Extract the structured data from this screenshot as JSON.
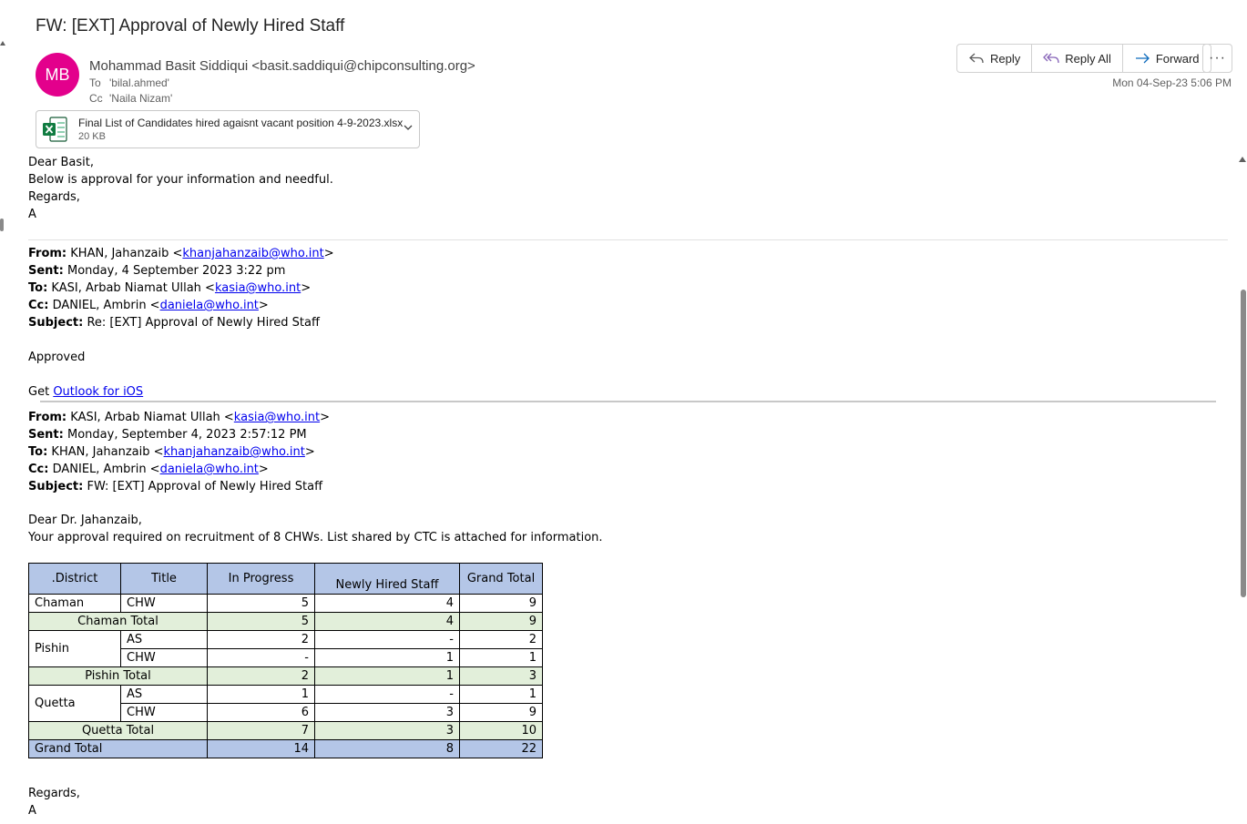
{
  "subject": "FW: [EXT] Approval of Newly Hired Staff",
  "sender": {
    "initials": "MB",
    "display": "Mohammad Basit Siddiqui <basit.saddiqui@chipconsulting.org>",
    "to_label": "To",
    "to": "'bilal.ahmed'",
    "cc_label": "Cc",
    "cc": "'Naila Nizam'"
  },
  "actions": {
    "reply": "Reply",
    "reply_all": "Reply All",
    "forward": "Forward",
    "more": "···"
  },
  "date": "Mon 04-Sep-23 5:06 PM",
  "attachment": {
    "name": "Final List of Candidates hired agaisnt vacant position 4-9-2023.xlsx",
    "size": "20 KB",
    "icon": "excel-icon"
  },
  "greeting": {
    "l1": "Dear Basit,",
    "l2": "Below is approval for your information and needful.",
    "l3": "Regards,",
    "l4": "A"
  },
  "fwd1": {
    "from_label": "From:",
    "from_name": "KHAN, Jahanzaib <",
    "from_email": "khanjahanzaib@who.int",
    "sent_label": "Sent:",
    "sent": "Monday, 4 September 2023 3:22 pm",
    "to_label": "To:",
    "to_name": "KASI, Arbab Niamat Ullah <",
    "to_email": "kasia@who.int",
    "cc_label": "Cc:",
    "cc_name": "DANIEL, Ambrin <",
    "cc_email": "daniela@who.int",
    "subject_label": "Subject:",
    "subject": "Re: [EXT] Approval of Newly Hired Staff",
    "body": "Approved",
    "get": "Get",
    "outlook_link": "Outlook for iOS"
  },
  "fwd2": {
    "from_label": "From:",
    "from_name": "KASI, Arbab Niamat Ullah <",
    "from_email": "kasia@who.int",
    "sent_label": "Sent:",
    "sent": "Monday, September 4, 2023 2:57:12 PM",
    "to_label": "To:",
    "to_name": "KHAN, Jahanzaib <",
    "to_email": "khanjahanzaib@who.int",
    "cc_label": "Cc:",
    "cc_name": "DANIEL, Ambrin <",
    "cc_email": "daniela@who.int",
    "subject_label": "Subject:",
    "subject": "FW: [EXT] Approval of Newly Hired Staff",
    "dear": "Dear Dr. Jahanzaib,",
    "body": "Your approval required on recruitment of 8 CHWs. List shared by CTC is attached for information."
  },
  "table": {
    "headers": [
      ".District",
      "Title",
      "In Progress",
      "Newly Hired Staff",
      "Grand Total"
    ],
    "rows": {
      "chaman_chw": [
        "Chaman",
        "CHW",
        "5",
        "4",
        "9"
      ],
      "chaman_total": [
        "Chaman Total",
        "5",
        "4",
        "9"
      ],
      "pishin_as": [
        "Pishin",
        "AS",
        "2",
        "-",
        "2"
      ],
      "pishin_chw": [
        "CHW",
        "-",
        "1",
        "1"
      ],
      "pishin_total": [
        "Pishin Total",
        "2",
        "1",
        "3"
      ],
      "quetta_as": [
        "Quetta",
        "AS",
        "1",
        "-",
        "1"
      ],
      "quetta_chw": [
        "CHW",
        "6",
        "3",
        "9"
      ],
      "quetta_total": [
        "Quetta Total",
        "7",
        "3",
        "10"
      ],
      "grand_total": [
        "Grand Total",
        "14",
        "8",
        "22"
      ]
    }
  },
  "closing": {
    "l1": "Regards,",
    "l2": "A"
  },
  "gt": ">"
}
